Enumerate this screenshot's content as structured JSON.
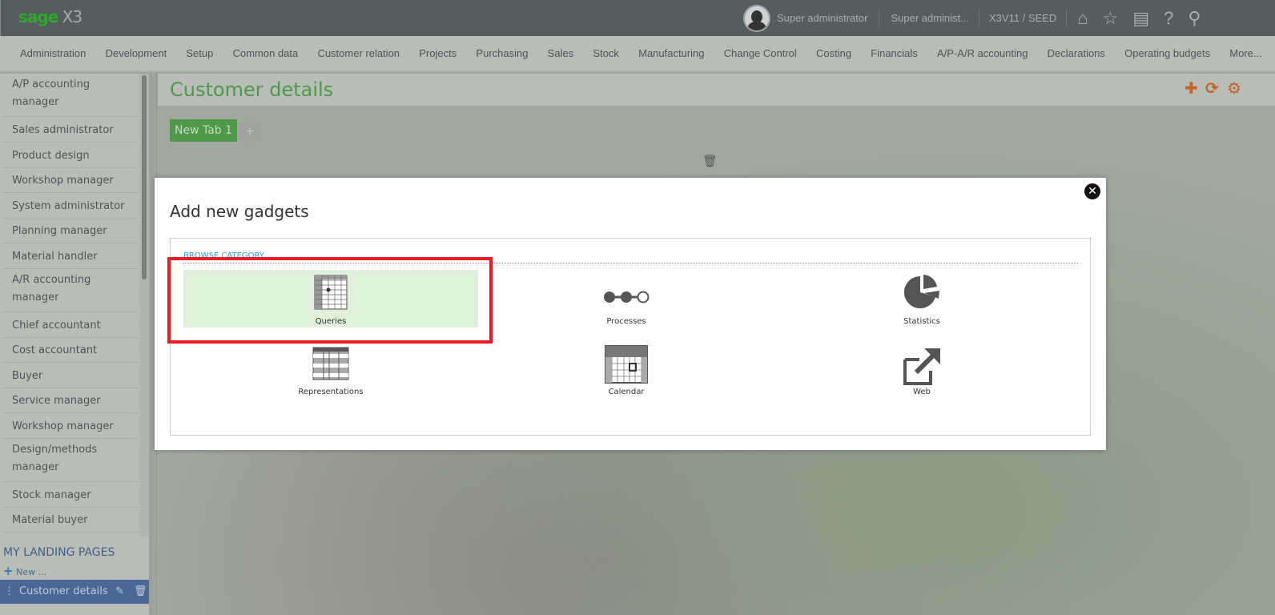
{
  "topbar": {
    "logo_brand": "sage",
    "logo_product": "X3",
    "user": "Super administrator",
    "role": "Super administ...",
    "endpoint": "X3V11 / SEED",
    "icons": [
      "home-icon",
      "star-icon",
      "layout-icon",
      "help-icon",
      "search-icon"
    ]
  },
  "menu": [
    "Administration",
    "Development",
    "Setup",
    "Common data",
    "Customer relation",
    "Projects",
    "Purchasing",
    "Sales",
    "Stock",
    "Manufacturing",
    "Change Control",
    "Costing",
    "Financials",
    "A/P-A/R accounting",
    "Declarations",
    "Operating budgets",
    "More..."
  ],
  "sidebar": {
    "items": [
      "A/P accounting manager",
      "Sales administrator",
      "Product design",
      "Workshop manager",
      "System administrator",
      "Planning manager",
      "Material handler",
      "A/R accounting manager",
      "Chief accountant",
      "Cost accountant",
      "Buyer",
      "Service manager",
      "Workshop manager",
      "Design/methods manager",
      "Stock manager",
      "Material buyer"
    ],
    "landing_title": "MY LANDING PAGES",
    "new_label": "New ...",
    "current": "Customer details"
  },
  "page": {
    "title": "Customer details",
    "tab": "New Tab 1",
    "add_tab": "+"
  },
  "modal": {
    "title": "Add new gadgets",
    "browse": "BROWSE CATEGORY",
    "gadgets": [
      {
        "label": "Queries",
        "selected": true
      },
      {
        "label": "Processes"
      },
      {
        "label": "Statistics"
      },
      {
        "label": "Representations"
      },
      {
        "label": "Calendar"
      },
      {
        "label": "Web"
      }
    ]
  },
  "colors": {
    "accent": "#4f9a4a",
    "action": "#c46428",
    "highlight": "#ee1c25",
    "selected_tile": "#dff0db"
  }
}
